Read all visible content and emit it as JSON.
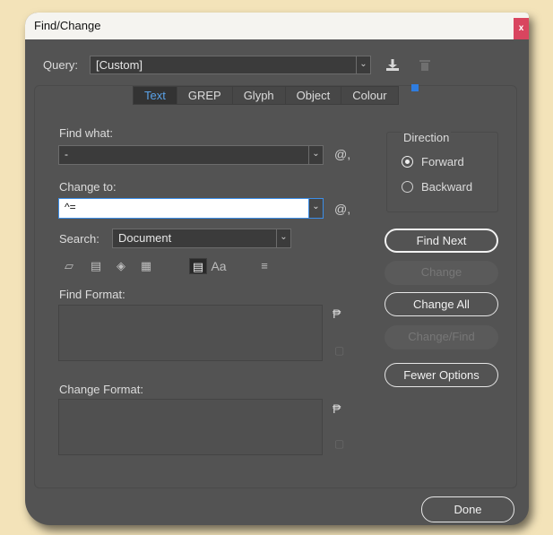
{
  "window": {
    "title": "Find/Change",
    "close": "x"
  },
  "query": {
    "label": "Query:",
    "value": "[Custom]",
    "save_icon": "save-query-icon",
    "delete_icon": "trash-icon"
  },
  "tabs": [
    {
      "label": "Text",
      "active": true
    },
    {
      "label": "GREP",
      "active": false
    },
    {
      "label": "Glyph",
      "active": false
    },
    {
      "label": "Object",
      "active": false
    },
    {
      "label": "Colour",
      "active": false
    }
  ],
  "find": {
    "label": "Find what:",
    "value": "-",
    "special_char": "@,"
  },
  "change": {
    "label": "Change to:",
    "value": "^=",
    "special_char": "@,"
  },
  "search": {
    "label": "Search:",
    "value": "Document"
  },
  "options_icons": [
    "include-locked-layers-icon",
    "include-locked-stories-icon",
    "include-hidden-layers-icon",
    "include-master-pages-icon",
    "include-footnotes-icon",
    "case-sensitive-icon",
    "whole-word-icon"
  ],
  "case_label": "Aa",
  "find_format": {
    "label": "Find Format:"
  },
  "change_format": {
    "label": "Change Format:"
  },
  "direction": {
    "label": "Direction",
    "options": [
      {
        "label": "Forward",
        "selected": true
      },
      {
        "label": "Backward",
        "selected": false
      }
    ]
  },
  "buttons": {
    "find_next": "Find Next",
    "change": "Change",
    "change_all": "Change All",
    "change_find": "Change/Find",
    "fewer_options": "Fewer Options",
    "done": "Done"
  },
  "colors": {
    "background": "#f3e3b9",
    "dialog": "#535353",
    "accent": "#2f7de0",
    "close": "#d9455f"
  }
}
